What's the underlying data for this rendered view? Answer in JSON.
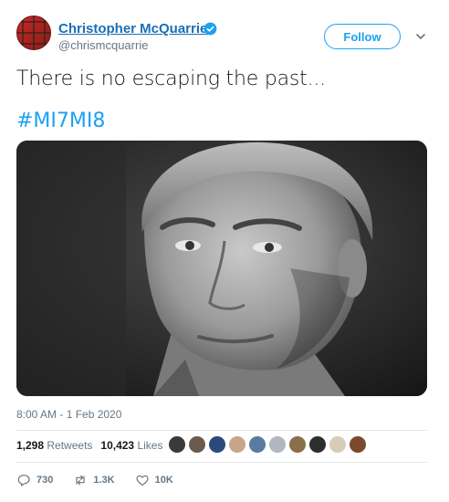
{
  "author": {
    "name": "Christopher McQuarrie",
    "handle": "@chrismcquarrie",
    "verified": true,
    "avatar": "tartan-plaid-avatar"
  },
  "follow_label": "Follow",
  "tweet": {
    "text": "There is no escaping the past...",
    "hashtag": "#MI7MI8",
    "image": "black-and-white-portrait-of-man",
    "timestamp": "8:00 AM - 1 Feb 2020"
  },
  "stats": {
    "retweets_count": "1,298",
    "retweets_label": "Retweets",
    "likes_count": "10,423",
    "likes_label": "Likes"
  },
  "likers": [
    "#3a3a3a",
    "#6b5a4e",
    "#2b4a7a",
    "#c7a58a",
    "#5a7aa0",
    "#b0b7bf",
    "#8a6f4a",
    "#2d2d2d",
    "#d7ccb8",
    "#7a4b2a"
  ],
  "actions": {
    "reply_count": "730",
    "retweet_count": "1.3K",
    "like_count": "10K"
  },
  "colors": {
    "accent": "#1da1f2",
    "name_link": "#1b6fb5",
    "secondary_text": "#657786"
  }
}
